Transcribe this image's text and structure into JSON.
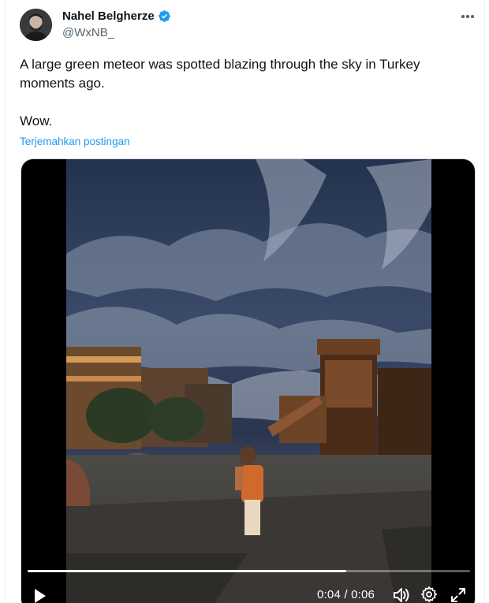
{
  "author": {
    "display_name": "Nahel Belgherze",
    "handle": "@WxNB_",
    "verified": true,
    "avatar_icon": "avatar-photo"
  },
  "tweet": {
    "text": "A large green meteor was spotted blazing through the sky in Turkey moments ago.\n\nWow.",
    "translate_label": "Terjemahkan postingan"
  },
  "video": {
    "current_time": "0:04",
    "duration": "0:06",
    "time_label": "0:04 / 0:06",
    "progress": 0.72,
    "controls": {
      "play_icon": "play-icon",
      "volume_icon": "volume-icon",
      "settings_icon": "gear-icon",
      "fullscreen_icon": "fullscreen-icon"
    }
  },
  "colors": {
    "accent": "#1d9bf0",
    "text_primary": "#0f1419",
    "text_secondary": "#536471"
  }
}
